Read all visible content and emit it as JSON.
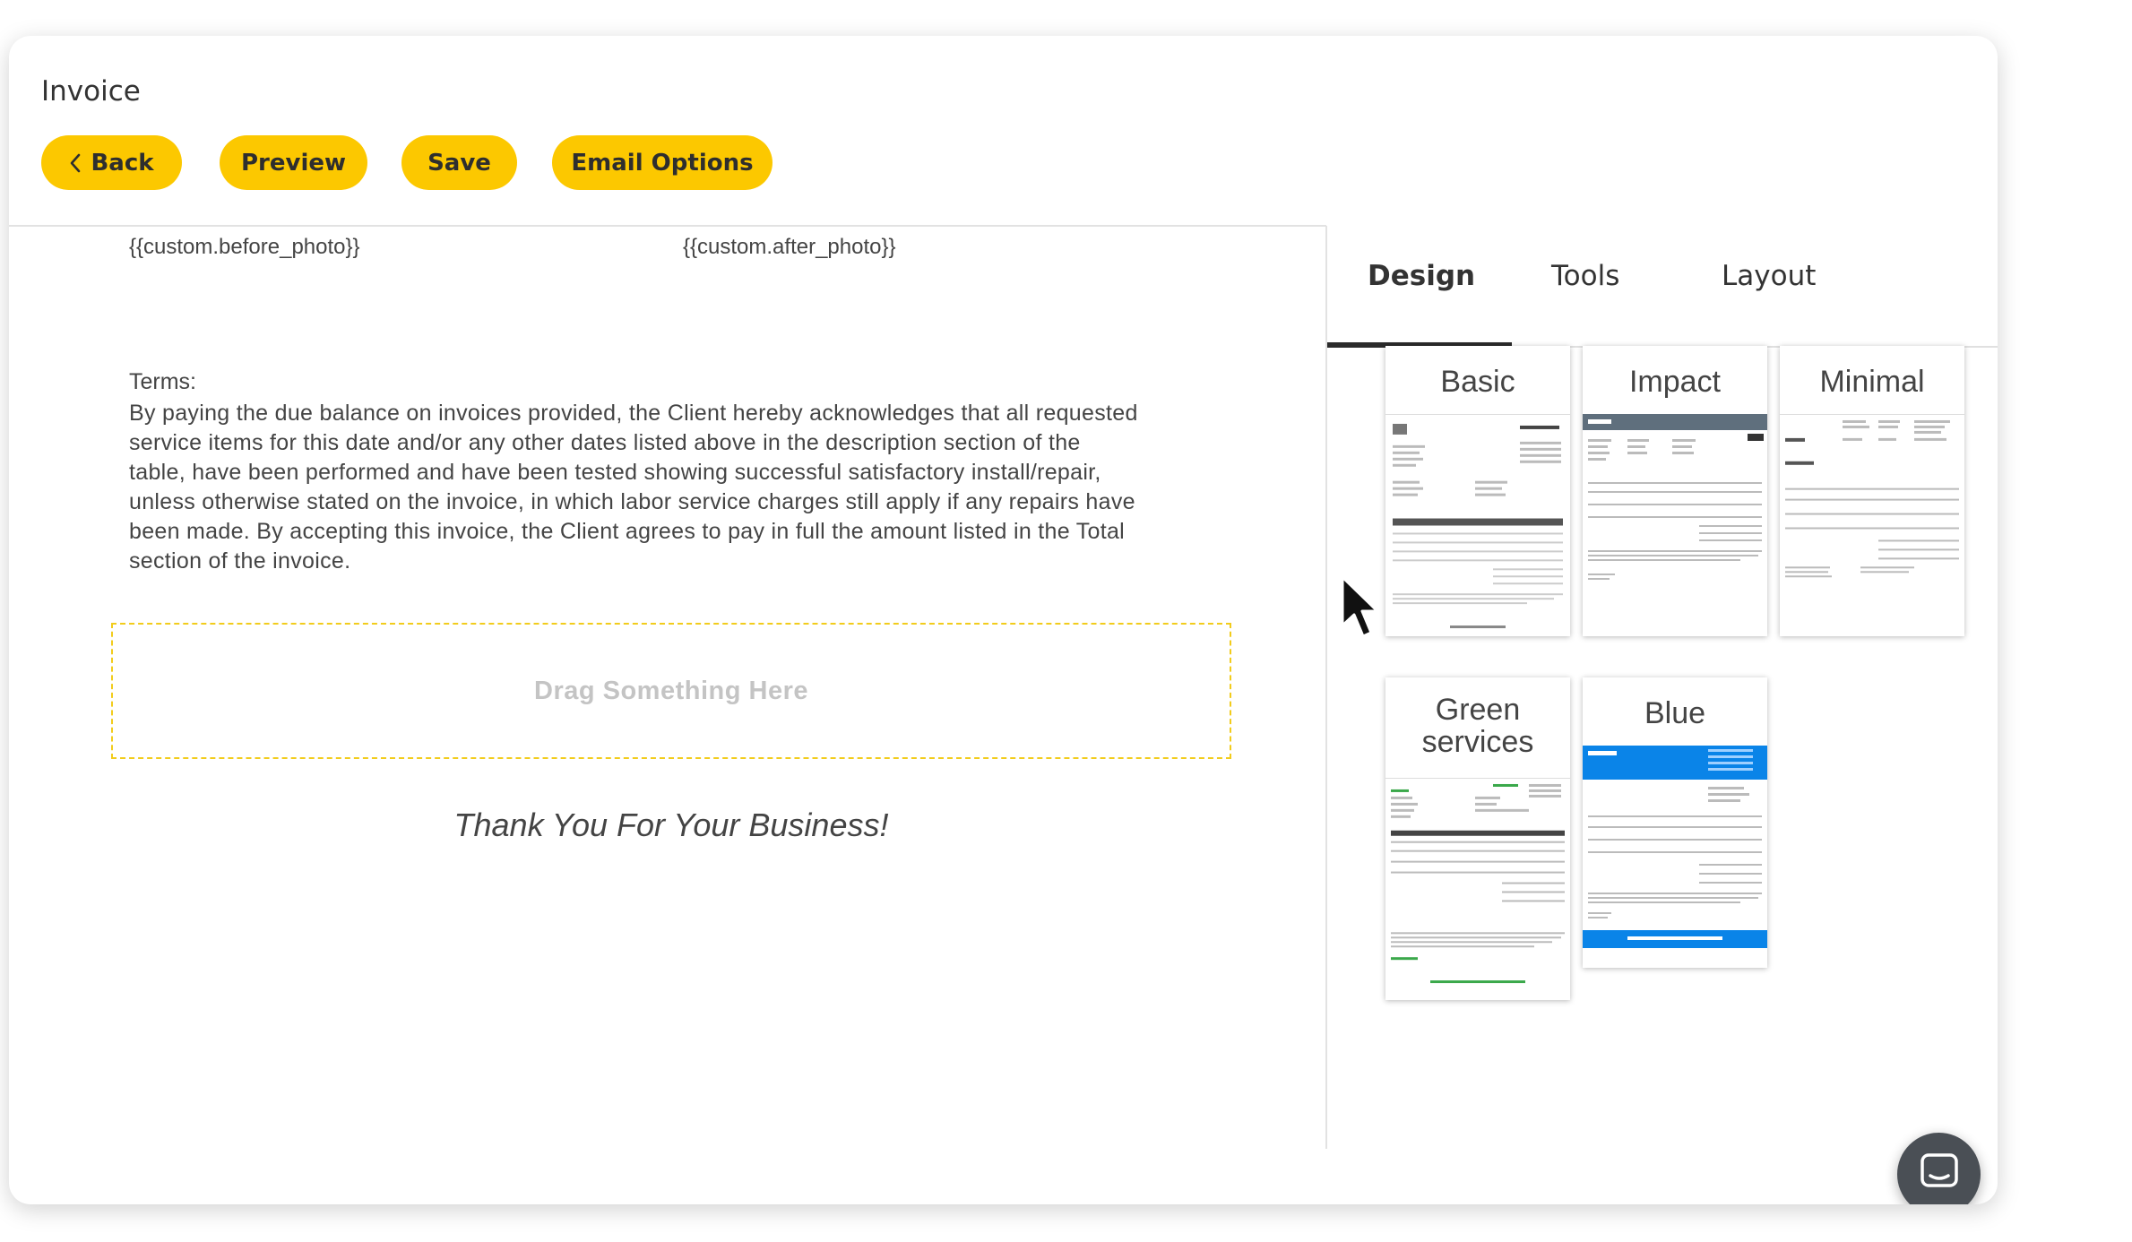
{
  "header": {
    "title": "Invoice"
  },
  "toolbar": {
    "back_label": "Back",
    "preview_label": "Preview",
    "save_label": "Save",
    "email_label": "Email Options"
  },
  "editor": {
    "before_photo": "{{custom.before_photo}}",
    "after_photo": "{{custom.after_photo}}",
    "terms_label": "Terms:",
    "terms_lines": [
      "By paying the due balance on invoices provided, the Client hereby acknowledges that all requested",
      "service items for this date and/or any other dates listed above in the description section of the",
      "table, have been performed and have been tested showing successful satisfactory install/repair,",
      "unless otherwise stated on the invoice, in which labor service charges still apply if any repairs have",
      "been made. By accepting this invoice, the Client agrees to pay in full the amount listed in the Total",
      "section of the invoice."
    ],
    "dropzone_label": "Drag Something Here",
    "thanks_text": "Thank You For Your Business!"
  },
  "panel": {
    "tabs": [
      "Design",
      "Tools",
      "Layout"
    ],
    "active_tab": "Design",
    "templates": [
      {
        "name": "Basic"
      },
      {
        "name": "Impact"
      },
      {
        "name": "Minimal"
      },
      {
        "name": "Green services"
      },
      {
        "name": "Blue"
      }
    ]
  },
  "colors": {
    "accent": "#fcc800",
    "dropzone_border": "#f2cc1c",
    "blue_template": "#0a84e8",
    "impact_header": "#5f6f7d",
    "green_template": "#3aa84a",
    "chat_button": "#4a4f55"
  },
  "icons": {
    "back": "chevron-left-icon",
    "chat": "chat-bubble-icon",
    "cursor": "mouse-pointer-icon"
  }
}
